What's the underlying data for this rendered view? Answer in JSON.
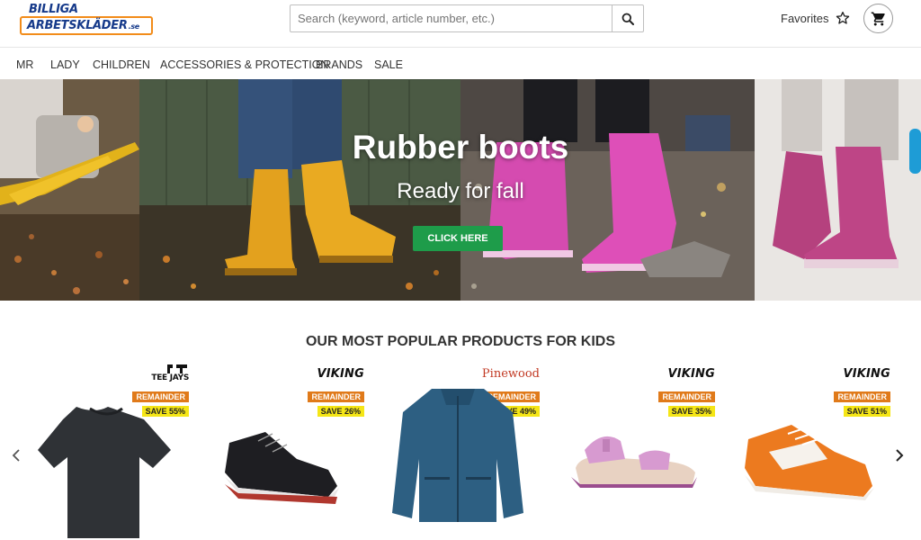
{
  "header": {
    "logo_top": "BILLIGA",
    "logo_bottom": "ARBETSKLÄDER",
    "logo_suffix": ".se",
    "search_placeholder": "Search (keyword, article number, etc.)",
    "search_icon": "search-icon",
    "favorites_label": "Favorites",
    "favorites_icon": "star-outline-icon",
    "cart_icon": "shopping-cart-icon"
  },
  "nav": {
    "items": [
      {
        "label": "MR"
      },
      {
        "label": "LADY"
      },
      {
        "label": "CHILDREN"
      },
      {
        "label": "ACCESSORIES & PROTECTION"
      },
      {
        "label": "BRANDS"
      },
      {
        "label": "SALE"
      }
    ]
  },
  "hero": {
    "title": "Rubber boots",
    "subtitle": "Ready for fall",
    "cta_label": "CLICK HERE",
    "cta_color": "#1e9c4a"
  },
  "products_section": {
    "title": "OUR MOST POPULAR PRODUCTS FOR KIDS",
    "prev_icon": "chevron-left-icon",
    "next_icon": "chevron-right-icon",
    "items": [
      {
        "brand": "TEE JAYS",
        "badge": "REMAINDER",
        "save": "SAVE 55%",
        "image": "black-t-shirt"
      },
      {
        "brand": "VIKING",
        "badge": "REMAINDER",
        "save": "SAVE 26%",
        "image": "black-sneaker"
      },
      {
        "brand": "Pinewood",
        "badge": "REMAINDER",
        "save": "SAVE 49%",
        "image": "blue-jacket"
      },
      {
        "brand": "VIKING",
        "badge": "REMAINDER",
        "save": "SAVE 35%",
        "image": "pink-sandal"
      },
      {
        "brand": "VIKING",
        "badge": "REMAINDER",
        "save": "SAVE 51%",
        "image": "orange-sneaker"
      }
    ]
  },
  "colors": {
    "remainder_badge": "#e07a1a",
    "save_badge": "#f5e616",
    "logo_blue": "#163a8a",
    "logo_orange": "#f28c1a"
  }
}
